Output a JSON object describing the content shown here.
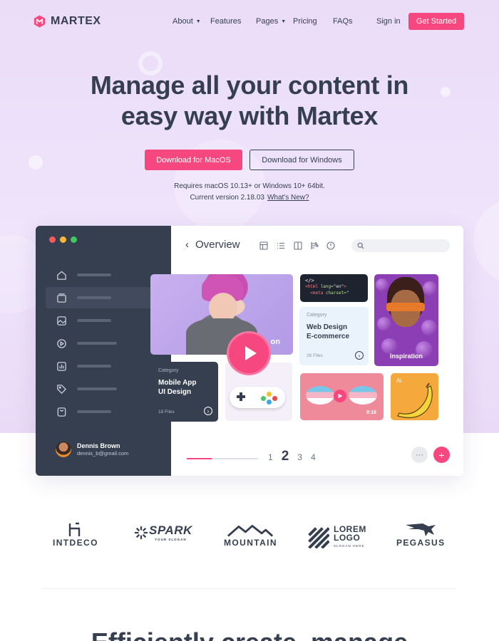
{
  "nav": {
    "logo_text": "MARTEX",
    "items": [
      {
        "label": "About",
        "has_caret": true
      },
      {
        "label": "Features",
        "has_caret": false
      },
      {
        "label": "Pages",
        "has_caret": true
      },
      {
        "label": "Pricing",
        "has_caret": false
      },
      {
        "label": "FAQs",
        "has_caret": false
      }
    ],
    "signin": "Sign in",
    "cta": "Get Started"
  },
  "hero": {
    "title_line1": "Manage all your content in",
    "title_line2": "easy way with Martex",
    "btn_mac": "Download for MacOS",
    "btn_windows": "Download for Windows",
    "requirements": "Requires macOS 10.13+ or Windows 10+ 64bit.",
    "version": "Current version 2.18.03",
    "whats_new": "What's New?"
  },
  "app": {
    "title": "Overview",
    "sidebar_icons": [
      "home-icon",
      "folder-icon",
      "image-icon",
      "play-icon",
      "chart-icon",
      "tag-icon",
      "bag-icon"
    ],
    "user": {
      "name": "Dennis Brown",
      "email": "dennis_b@gmail.com"
    },
    "cards": {
      "video_label": "on",
      "code_lines": [
        "<html lang=\"en\">",
        "<meta charset=\""
      ],
      "web": {
        "category": "Category",
        "title1": "Web Design",
        "title2": "E-commerce",
        "files": "26 Files"
      },
      "inspiration_label": "Inspiration",
      "mobile": {
        "category": "Category",
        "title1": "Mobile App",
        "title2": "UI Design",
        "files": "18 Files"
      },
      "video_time": "0:16",
      "ai_label": "Ai"
    },
    "pagination": [
      "1",
      "2",
      "3",
      "4"
    ],
    "current_page": "2",
    "progress": 0.35,
    "more_label": "···",
    "plus_label": "+"
  },
  "brands": [
    {
      "name": "INTDECO"
    },
    {
      "name": "SPARK",
      "tagline": "YOUR SLOGAN"
    },
    {
      "name": "MOUNTAIN"
    },
    {
      "name": "LOREM",
      "name2": "LOGO",
      "tagline": "SLOGAN HERE"
    },
    {
      "name": "PEGASUS"
    }
  ],
  "section": {
    "title_partial": "Efficiently create, manage"
  },
  "colors": {
    "accent": "#f74780",
    "dark": "#353f4f",
    "hero_bg": "#ecdffa"
  }
}
